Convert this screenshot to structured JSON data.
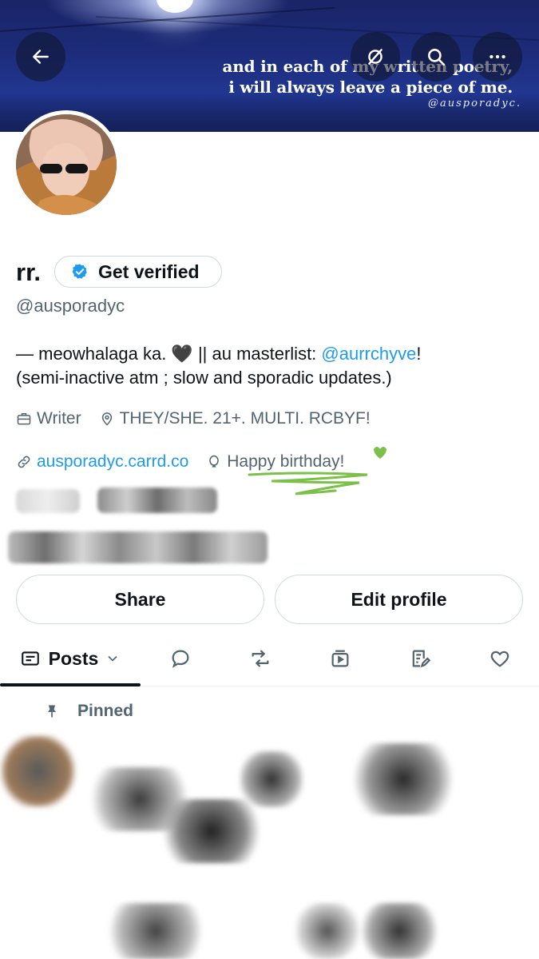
{
  "banner": {
    "quote_line1": "and in each of my written poetry,",
    "quote_line2": "i will always leave a piece of me.",
    "signature": "@ausporadyc."
  },
  "header_buttons": {
    "back": "back-arrow-icon",
    "grok": "grok-icon",
    "search": "search-icon",
    "more": "more-icon"
  },
  "profile": {
    "display_name": "rr.",
    "verify_label": "Get verified",
    "handle": "@ausporadyc",
    "bio_part1": "— meowhalaga ka. 🖤 || au masterlist: ",
    "bio_mention": "@aurrchyve",
    "bio_part2": "!",
    "bio_line2": "(semi-inactive atm ; slow and sporadic updates.)",
    "profession": "Writer",
    "location": "THEY/SHE. 21+. MULTI. RCBYF!",
    "website": "ausporadyc.carrd.co",
    "birthday": "Happy birthday!"
  },
  "actions": {
    "share": "Share",
    "edit_profile": "Edit profile"
  },
  "tabs": {
    "posts": "Posts",
    "icons": [
      "replies-icon",
      "reposts-icon",
      "media-icon",
      "articles-icon",
      "likes-icon"
    ]
  },
  "pinned_label": "Pinned",
  "colors": {
    "accent": "#1d9bf0",
    "text": "#0f1419",
    "secondary": "#536471",
    "border": "#cfd9de",
    "doodle": "#7cc04a"
  }
}
